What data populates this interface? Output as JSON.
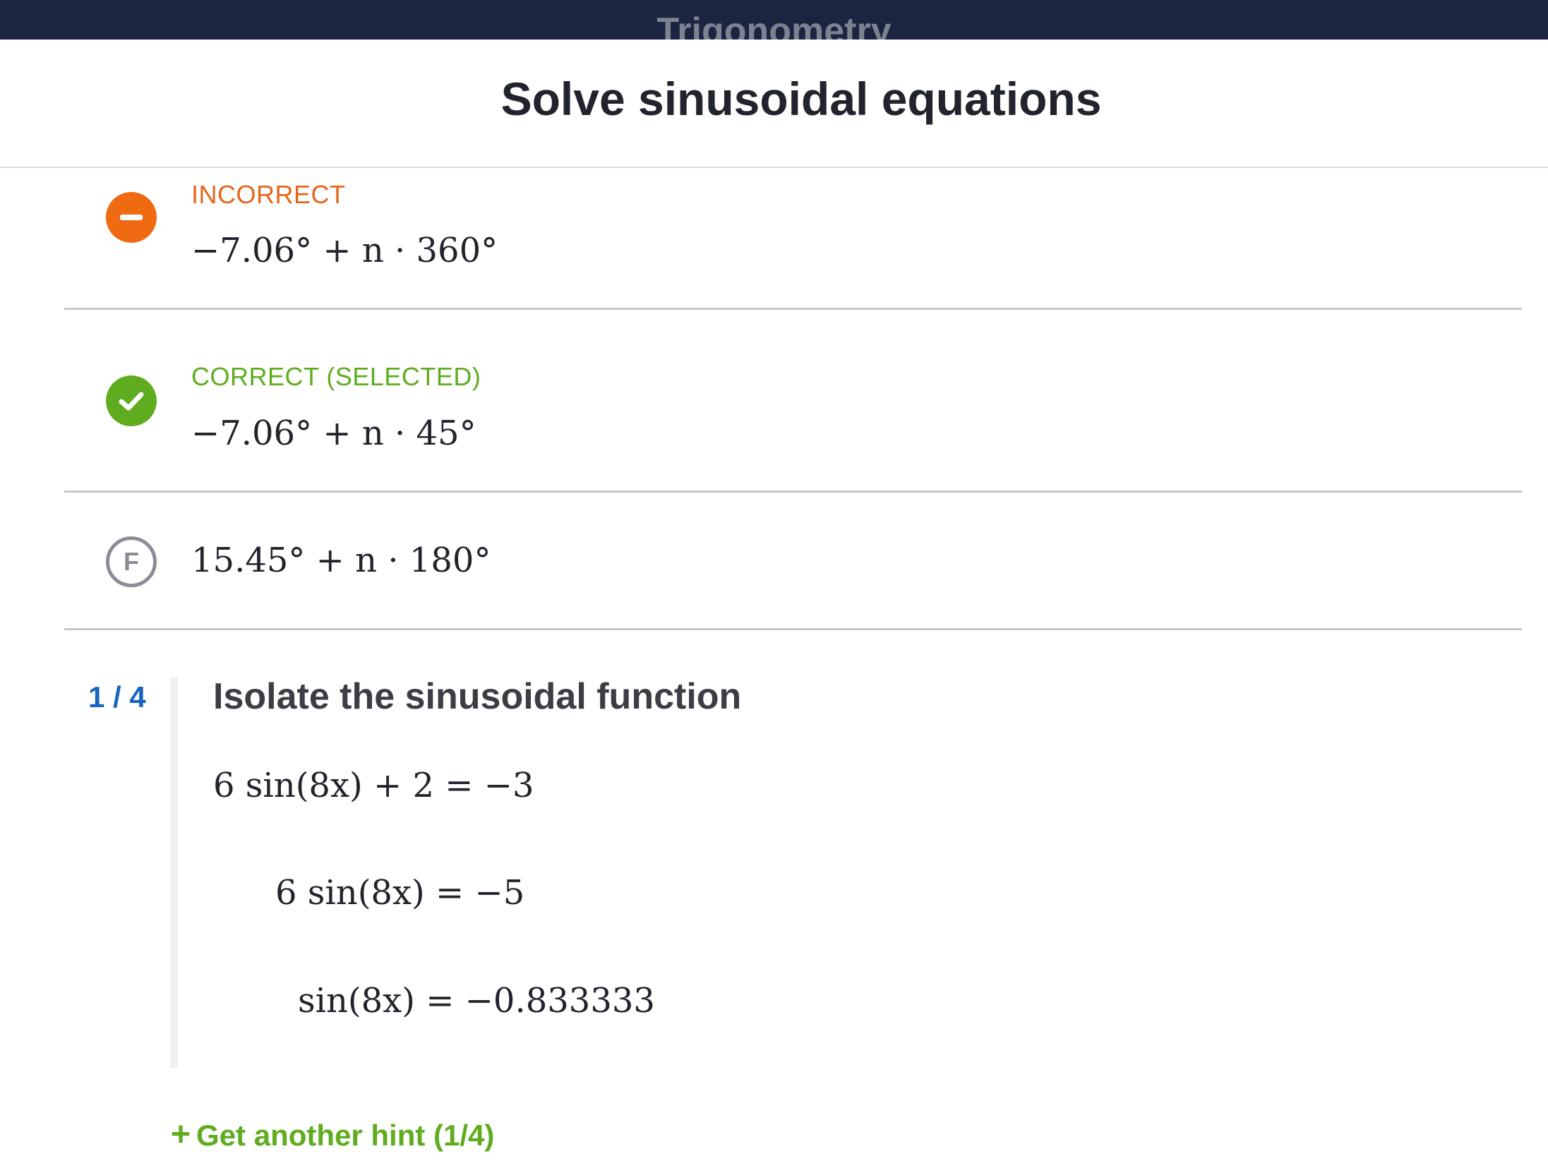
{
  "topbar": {
    "title": "Trigonometry"
  },
  "page": {
    "title": "Solve sinusoidal equations"
  },
  "choices": [
    {
      "status": "INCORRECT",
      "expression": "−7.06° + n · 360°",
      "icon": "minus-icon",
      "color": "#f06a12"
    },
    {
      "status": "CORRECT (SELECTED)",
      "expression": "−7.06° + n · 45°",
      "icon": "check-icon",
      "color": "#5fac1f"
    },
    {
      "letter": "F",
      "expression": "15.45° + n · 180°"
    }
  ],
  "hint": {
    "counter": "1 / 4",
    "title": "Isolate the sinusoidal function",
    "steps": [
      "6 sin(8x) + 2 = −3",
      "6 sin(8x) = −5",
      "sin(8x) = −0.833333"
    ],
    "more_plus": "+",
    "more_label": "Get another hint (1/4)"
  }
}
